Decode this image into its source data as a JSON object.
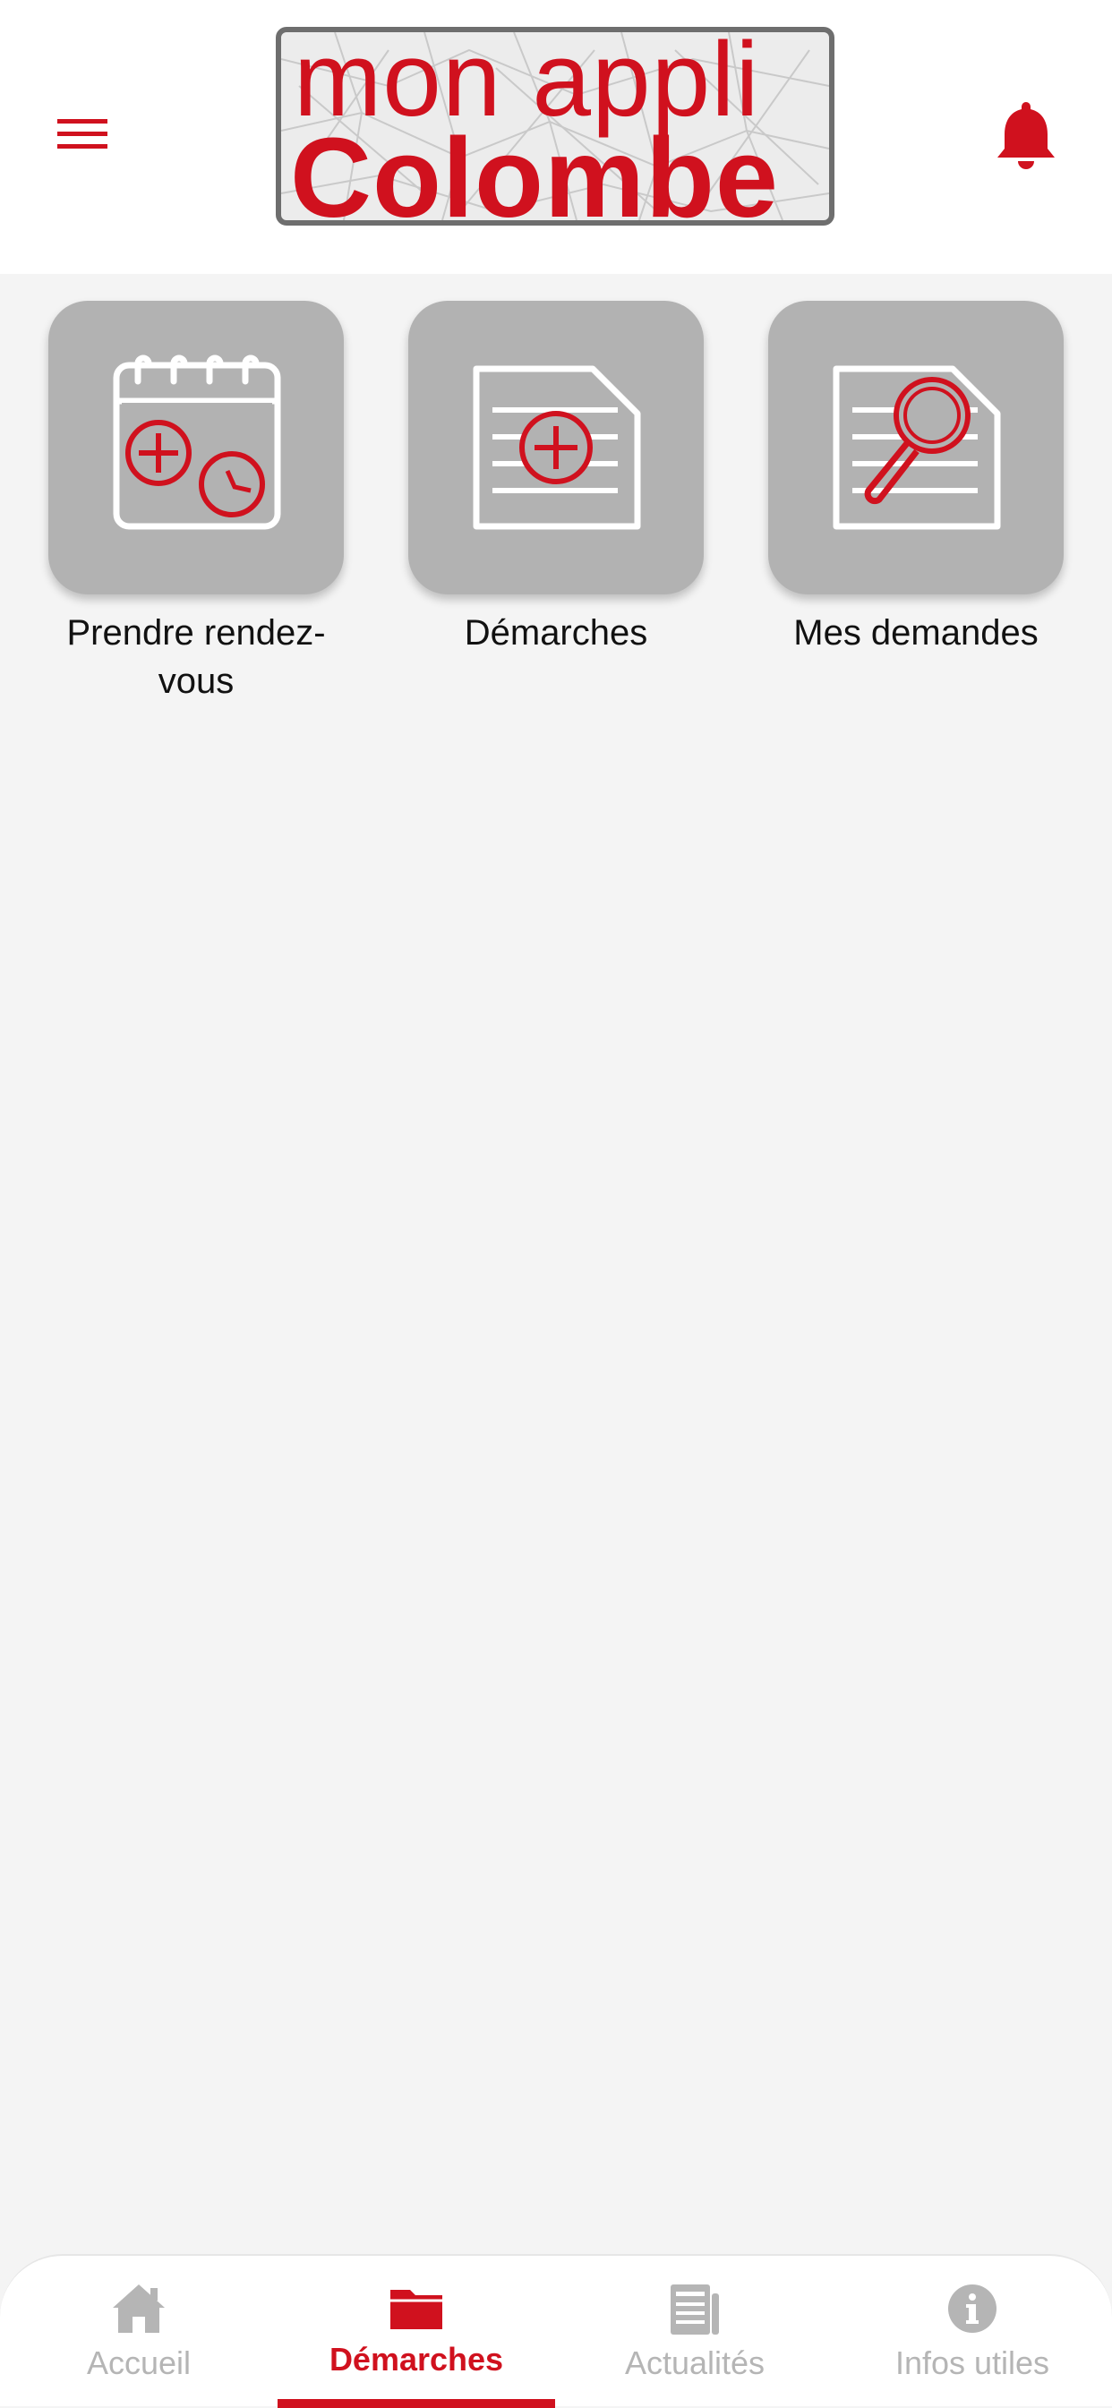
{
  "header": {
    "logo_line1": "mon appli",
    "logo_line2": "Colombe",
    "menu_icon": "hamburger-menu-icon",
    "notification_icon": "bell-icon"
  },
  "tiles": [
    {
      "label": "Prendre rendez-\nvous",
      "icon": "calendar-plus-clock-icon"
    },
    {
      "label": "Démarches",
      "icon": "document-plus-icon"
    },
    {
      "label": "Mes demandes",
      "icon": "document-search-icon"
    }
  ],
  "tabbar": {
    "tabs": [
      {
        "label": "Accueil",
        "icon": "home-icon",
        "active": false
      },
      {
        "label": "Démarches",
        "icon": "folder-icon",
        "active": true
      },
      {
        "label": "Actualités",
        "icon": "newspaper-icon",
        "active": false
      },
      {
        "label": "Infos utiles",
        "icon": "info-icon",
        "active": false
      }
    ]
  },
  "colors": {
    "brand": "#d0111e",
    "tile_bg": "#b2b2b2",
    "page_bg": "#f4f4f4",
    "inactive_tab": "#b5b5b5"
  }
}
